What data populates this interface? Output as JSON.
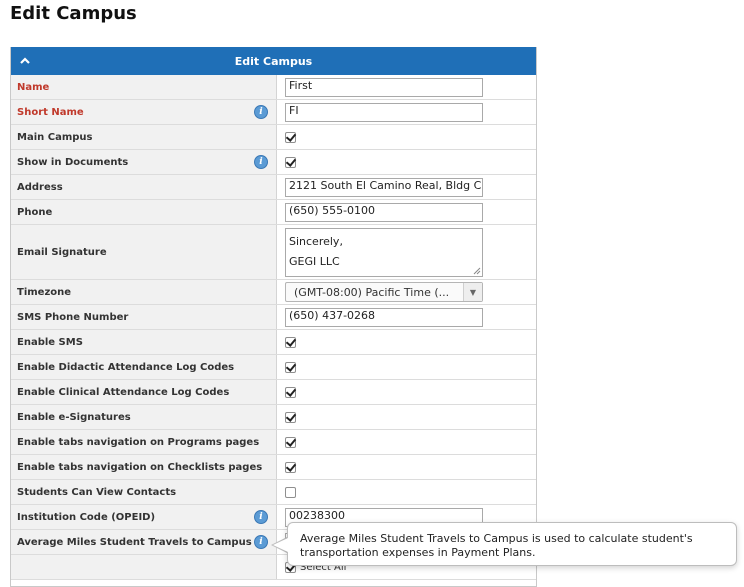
{
  "page": {
    "title": "Edit Campus"
  },
  "panel": {
    "title": "Edit Campus"
  },
  "fields": {
    "name": {
      "label": "Name",
      "value": "First"
    },
    "short_name": {
      "label": "Short Name",
      "value": "FI"
    },
    "main_campus": {
      "label": "Main Campus",
      "checked": true
    },
    "show_in_documents": {
      "label": "Show in Documents",
      "checked": true
    },
    "address": {
      "label": "Address",
      "value": "2121 South El Camino Real, Bldg C"
    },
    "phone": {
      "label": "Phone",
      "value": "(650) 555-0100"
    },
    "email_signature": {
      "label": "Email Signature",
      "line1": "Sincerely,",
      "line2": "GEGI LLC"
    },
    "timezone": {
      "label": "Timezone",
      "value": "(GMT-08:00) Pacific Time (..."
    },
    "sms_phone": {
      "label": "SMS Phone Number",
      "value": "(650) 437-0268"
    },
    "enable_sms": {
      "label": "Enable SMS",
      "checked": true
    },
    "enable_didactic": {
      "label": "Enable Didactic Attendance Log Codes",
      "checked": true
    },
    "enable_clinical": {
      "label": "Enable Clinical Attendance Log Codes",
      "checked": true
    },
    "enable_esignatures": {
      "label": "Enable e-Signatures",
      "checked": true
    },
    "enable_tabs_programs": {
      "label": "Enable tabs navigation on Programs pages",
      "checked": true
    },
    "enable_tabs_checklists": {
      "label": "Enable tabs navigation on Checklists pages",
      "checked": true
    },
    "students_view_contacts": {
      "label": "Students Can View Contacts",
      "checked": false
    },
    "institution_code": {
      "label": "Institution Code (OPEID)",
      "value": "00238300"
    },
    "avg_miles": {
      "label": "Average Miles Student Travels to Campus",
      "value": ""
    },
    "next_row": {
      "partial": "Select All"
    }
  },
  "tooltip": {
    "text": "Average Miles Student Travels to Campus is used to calculate student's transportation expenses in Payment Plans."
  },
  "colors": {
    "header": "#1f6fb7",
    "required": "#c0392b",
    "info": "#5b9bd5"
  }
}
